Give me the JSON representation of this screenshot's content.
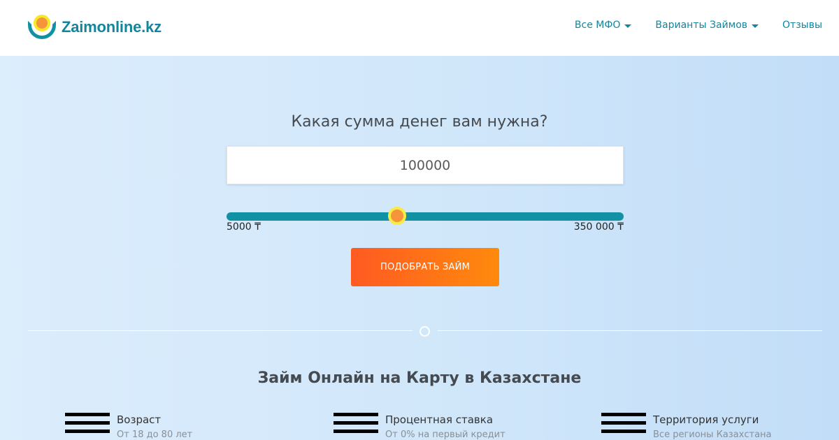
{
  "header": {
    "logo_text": "Zaimonline.kz",
    "nav": [
      {
        "label": "Все МФО",
        "has_dropdown": true
      },
      {
        "label": "Варианты Займов",
        "has_dropdown": true
      },
      {
        "label": "Отзывы",
        "has_dropdown": false
      }
    ]
  },
  "hero": {
    "question": "Какая сумма денег вам нужна?",
    "amount_value": "100000",
    "slider": {
      "min_label": "5000 ₸",
      "max_label": "350 000 ₸",
      "min": 5000,
      "max": 350000,
      "value": 100000
    },
    "cta_label": "ПОДОБРАТЬ ЗАЙМ"
  },
  "section": {
    "title": "Займ Онлайн на Карту в Казахстане",
    "features": [
      {
        "title": "Возраст",
        "subtitle": "От 18 до 80 лет",
        "icon": "menu-icon"
      },
      {
        "title": "Процентная ставка",
        "subtitle": "От 0% на первый кредит",
        "icon": "menu-icon"
      },
      {
        "title": "Территория услуги",
        "subtitle": "Все регионы Казахстана",
        "icon": "menu-icon"
      }
    ]
  },
  "colors": {
    "brand": "#14869b",
    "accent_start": "#ff5a22",
    "accent_end": "#ff8a0c",
    "thumb": "#f5943a",
    "thumb_border": "#f6ec43",
    "hero_bg": "#d4e9fb"
  }
}
